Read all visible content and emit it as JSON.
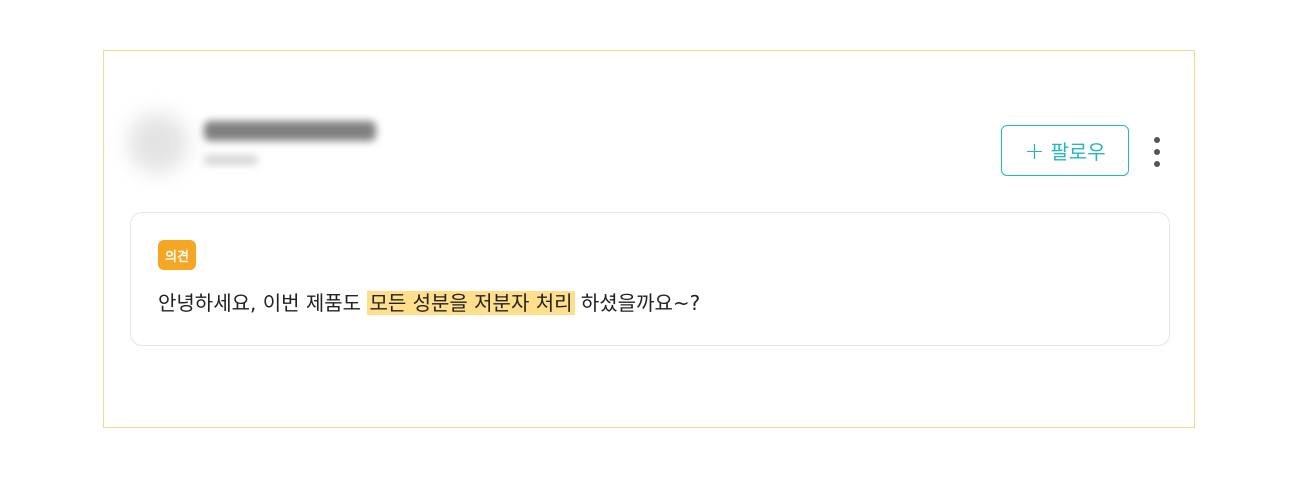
{
  "post": {
    "follow_button": {
      "icon": "plus-icon",
      "label": "팔로우",
      "color": "#23b8bf"
    },
    "more_menu": {
      "icon": "more-vertical-icon"
    },
    "opinion": {
      "tag": "의견",
      "tag_color": "#f5a623",
      "text_before": "안녕하세요, 이번 제품도",
      "text_highlight": "모든 성분을 저분자 처리",
      "highlight_color": "#ffdf8c",
      "text_after": "하셨을까요~?"
    }
  }
}
